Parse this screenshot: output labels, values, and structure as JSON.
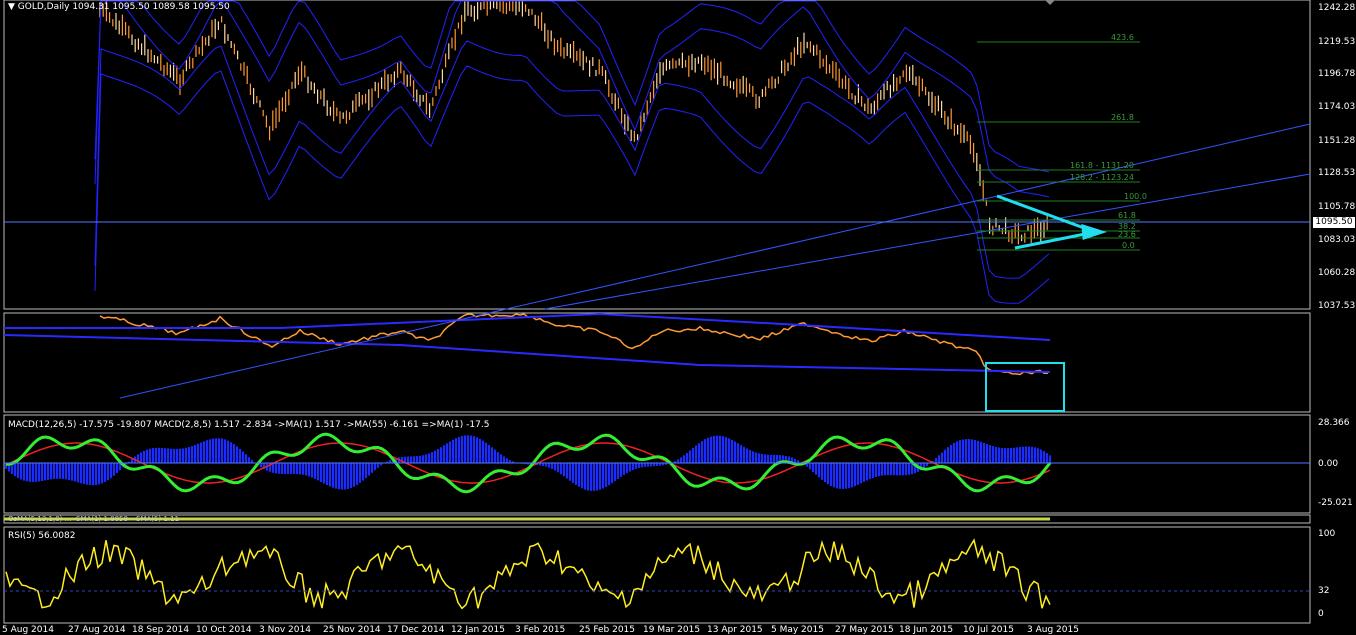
{
  "header": {
    "symbol": "GOLD,Daily",
    "ohlc": "1094.31 1095.50 1089.58 1095.50"
  },
  "current_price": "1095.50",
  "price_axis": [
    "1242.28",
    "1219.53",
    "1196.78",
    "1174.03",
    "1151.28",
    "1128.53",
    "1105.78",
    "1083.03",
    "1060.28",
    "1037.53"
  ],
  "date_axis": [
    "5 Aug 2014",
    "27 Aug 2014",
    "18 Sep 2014",
    "10 Oct 2014",
    "3 Nov 2014",
    "25 Nov 2014",
    "17 Dec 2014",
    "12 Jan 2015",
    "3 Feb 2015",
    "25 Feb 2015",
    "19 Mar 2015",
    "13 Apr 2015",
    "5 May 2015",
    "27 May 2015",
    "18 Jun 2015",
    "10 Jul 2015",
    "3 Aug 2015"
  ],
  "fib_levels": [
    "423.6",
    "261.8",
    "161.8 - 1131.20",
    "128.2 - 1123.24",
    "100.0",
    "61.8",
    "38.2",
    "23.6",
    "0.0"
  ],
  "macd": {
    "header": "MACD(12,26,5) -17.575 -19.807  MACD(2,8,5) 1.517 -2.834  ->MA(1) 1.517  ->MA(55) -6.161  =>MA(1) -17.5",
    "axis": [
      "28.366",
      "0.00",
      "-25.021"
    ]
  },
  "osma": {
    "header": "OsMA(5,13,1,8) ... -SMA(1) 1.8858 ~SMA(5) 1.11"
  },
  "rsi": {
    "header": "RSI(5) 56.0082",
    "axis": [
      "100",
      "32",
      "0"
    ]
  },
  "colors": {
    "background": "#000000",
    "candle_up": "#ff9933",
    "bands": "#2222ff",
    "triangle": "#22ddee",
    "fib": "#1f7f1f",
    "macd_fast": "#33ee33",
    "macd_signal": "#ee2222",
    "histogram": "#1a2cff",
    "rsi": "#ffee22"
  }
}
